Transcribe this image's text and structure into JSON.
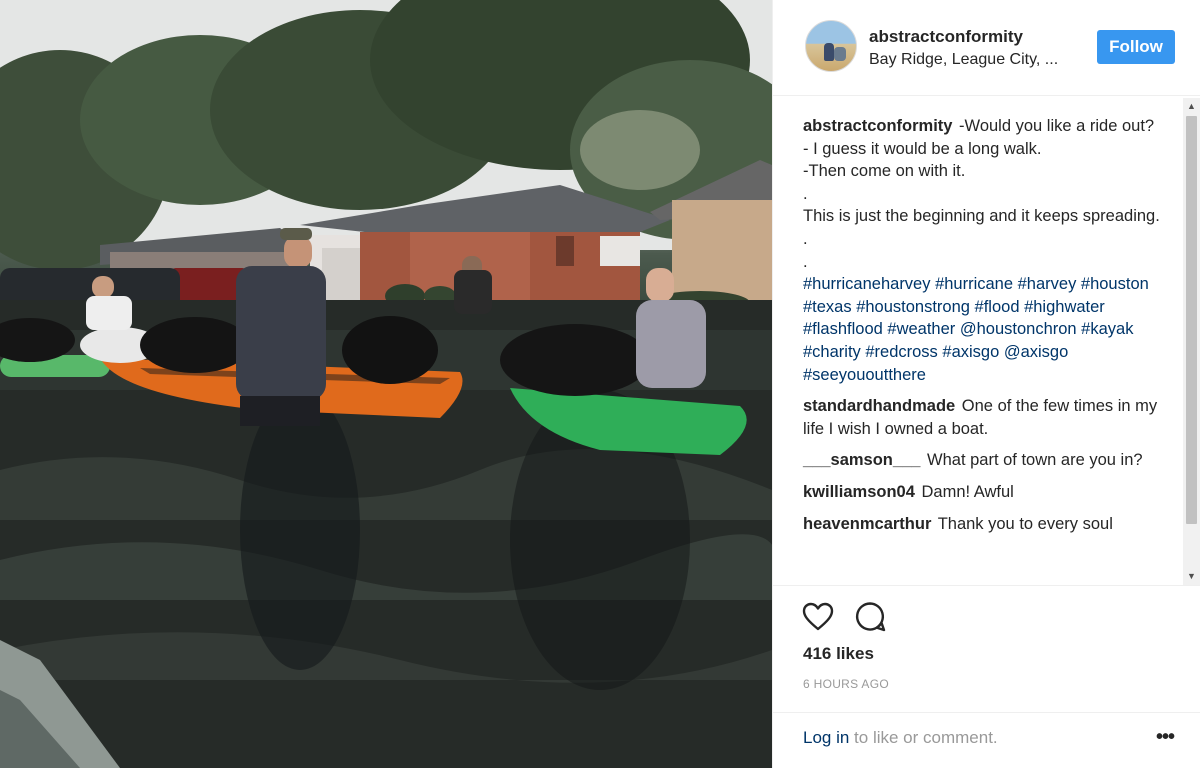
{
  "post": {
    "username": "abstractconformity",
    "location": "Bay Ridge, League City, ...",
    "follow_label": "Follow"
  },
  "caption": {
    "author": "abstractconformity",
    "lines": [
      "-Would you like a ride out?",
      "- I guess it would be a long walk.",
      "-Then come on with it.",
      ".",
      "This is just the beginning and it keeps spreading.",
      ".",
      "."
    ],
    "hashtags": "#hurricaneharvey #hurricane #harvey #houston #texas #houstonstrong #flood #highwater #flashflood #weather @houstonchron #kayak #charity #redcross #axisgo @axisgo #seeyououtthere"
  },
  "comments": [
    {
      "author": "standardhandmade",
      "text": "One of the few times in my life I wish I owned a boat."
    },
    {
      "author": "___samson___",
      "text": "What part of town are you in?"
    },
    {
      "author": "kwilliamson04",
      "text": "Damn! Awful"
    },
    {
      "author": "heavenmcarthur",
      "text": "Thank you to every soul"
    }
  ],
  "actions": {
    "likes_text": "416 likes",
    "time_text": "6 HOURS AGO",
    "like_icon": "heart-icon",
    "comment_icon": "speech-bubble-icon"
  },
  "footer": {
    "login_label": "Log in",
    "login_suffix": " to like or comment.",
    "more_icon": "more-options-icon",
    "more_label": "•••"
  },
  "colors": {
    "follow_button": "#3897f0",
    "link": "#003569",
    "text": "#262626",
    "muted": "#999999",
    "divider": "#efefef"
  }
}
